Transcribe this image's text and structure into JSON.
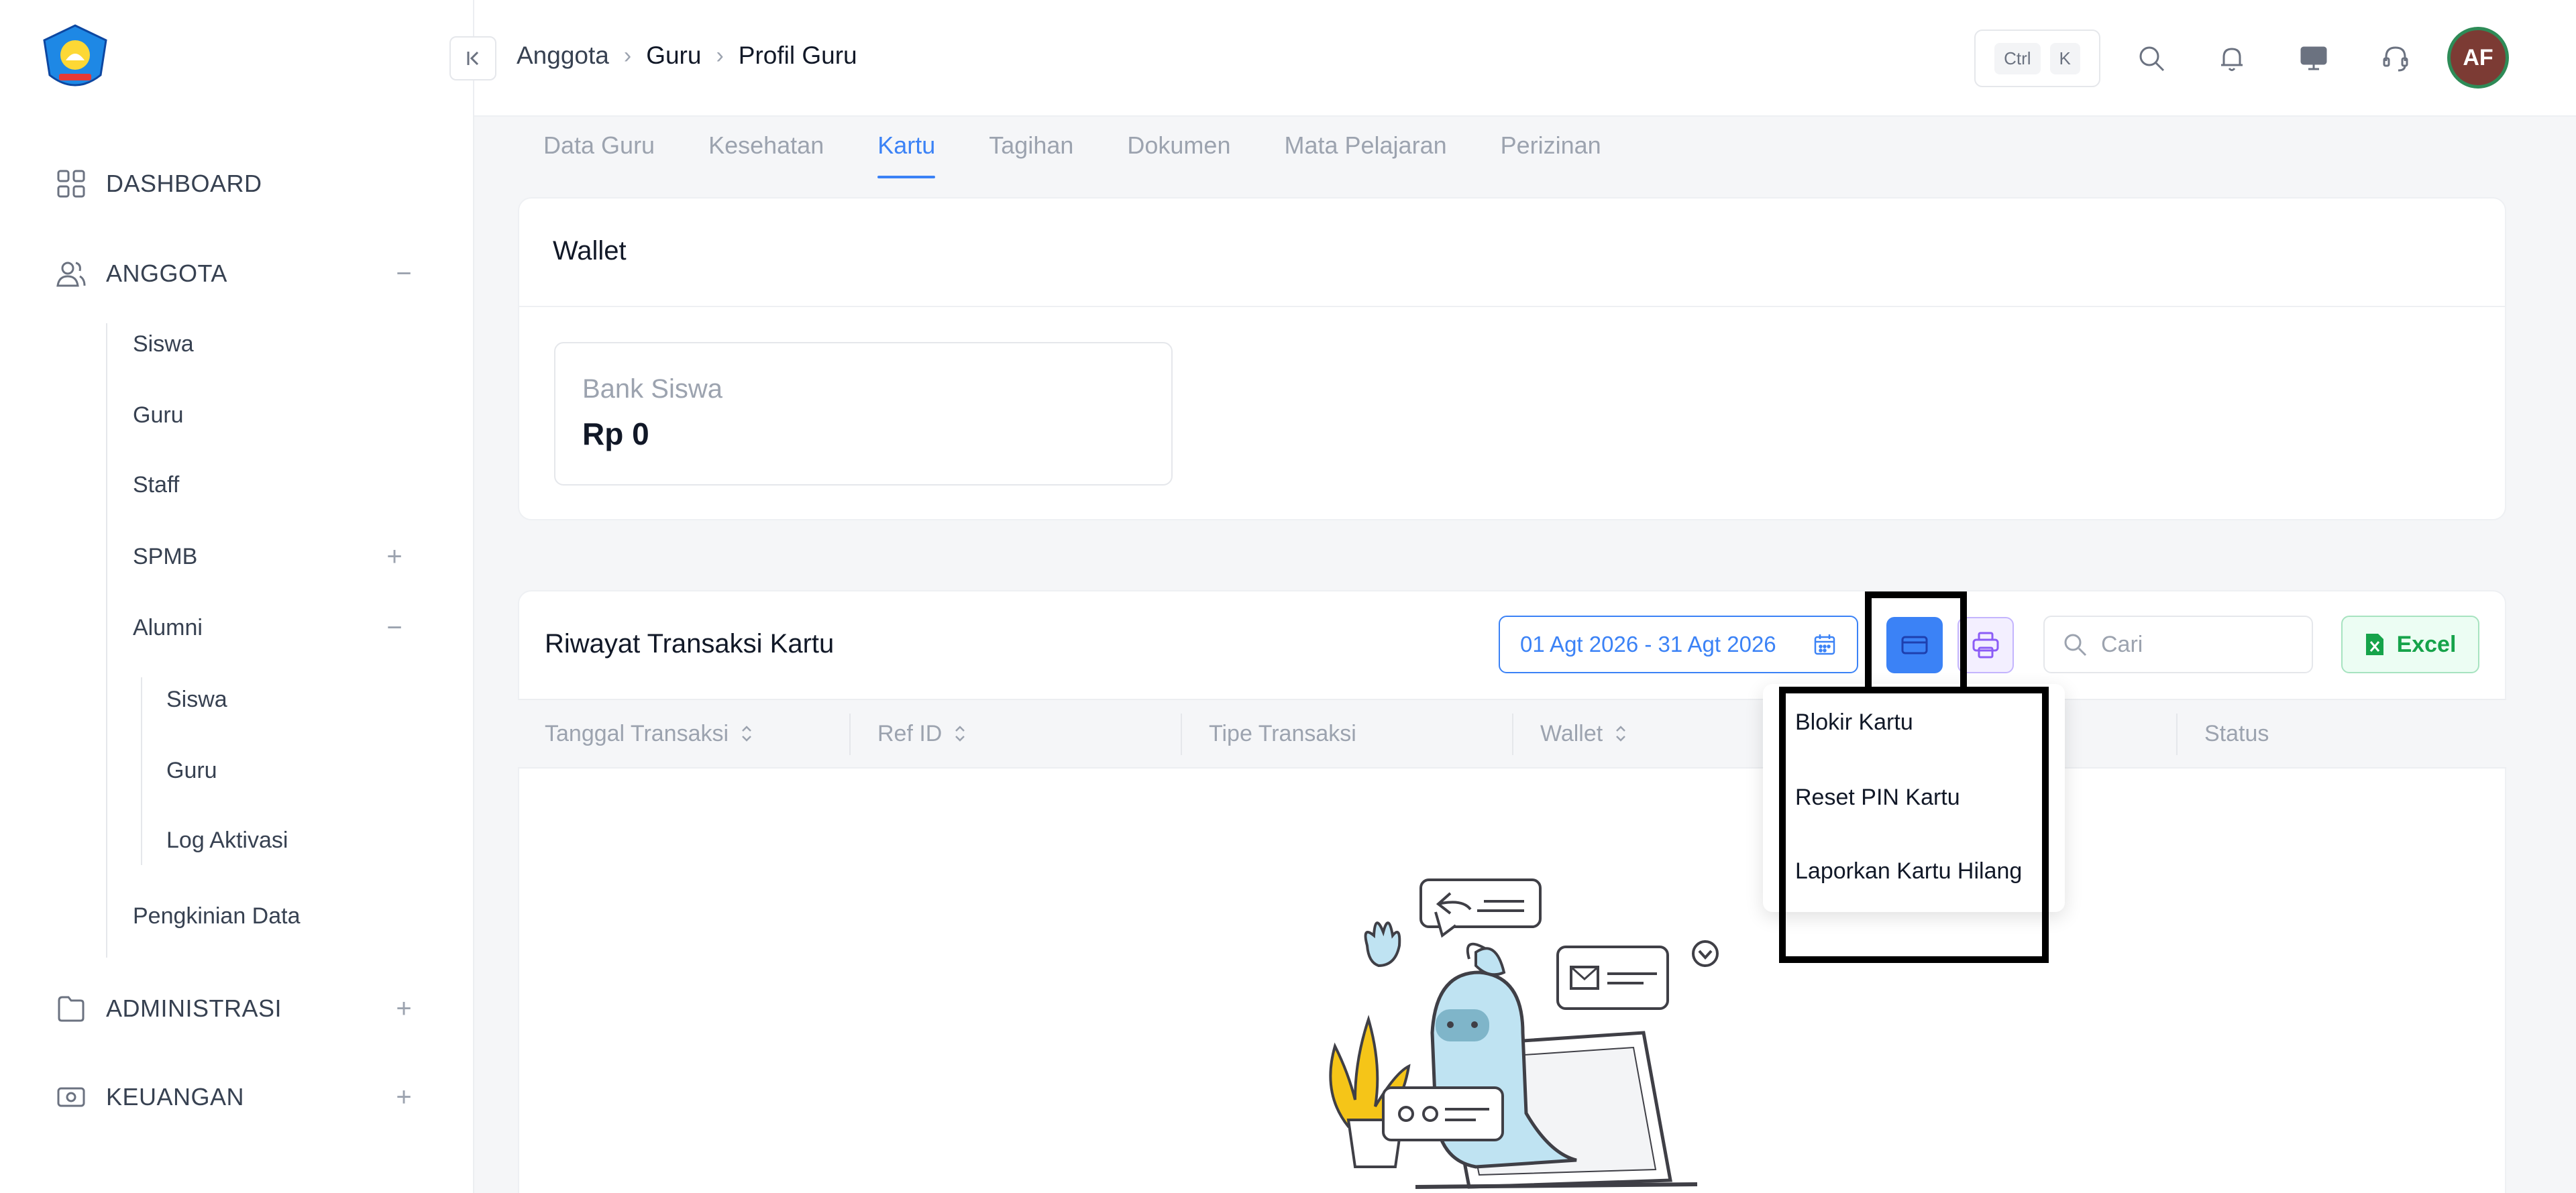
{
  "sidebar": {
    "items": [
      {
        "label": "DASHBOARD",
        "icon": "grid-icon"
      },
      {
        "label": "ANGGOTA",
        "icon": "users-icon",
        "toggle": "−"
      },
      {
        "label": "ADMINISTRASI",
        "icon": "folder-icon",
        "toggle": "+"
      },
      {
        "label": "KEUANGAN",
        "icon": "money-icon",
        "toggle": "+"
      }
    ],
    "anggota_sub": {
      "siswa": "Siswa",
      "guru": "Guru",
      "staff": "Staff",
      "spmb": "SPMB",
      "spmb_toggle": "+",
      "alumni": "Alumni",
      "alumni_toggle": "−",
      "alumni_siswa": "Siswa",
      "alumni_guru": "Guru",
      "log_aktivasi": "Log Aktivasi",
      "pengkinian": "Pengkinian Data"
    }
  },
  "breadcrumb": {
    "items": [
      "Anggota",
      "Guru",
      "Profil Guru"
    ],
    "separator": "›"
  },
  "topbar": {
    "kbd_ctrl": "Ctrl",
    "kbd_k": "K",
    "avatar_initials": "AF"
  },
  "tabs": [
    "Data Guru",
    "Kesehatan",
    "Kartu",
    "Tagihan",
    "Dokumen",
    "Mata Pelajaran",
    "Perizinan"
  ],
  "active_tab": "Kartu",
  "wallet": {
    "title": "Wallet",
    "bank_label": "Bank Siswa",
    "bank_amount": "Rp 0"
  },
  "transactions": {
    "title": "Riwayat Transaksi Kartu",
    "date_range": "01 Agt 2026 - 31 Agt 2026",
    "search_placeholder": "Cari",
    "excel_label": "Excel",
    "columns": [
      "Tanggal Transaksi",
      "Ref ID",
      "Tipe Transaksi",
      "Wallet",
      "Status"
    ]
  },
  "dropdown": {
    "items": [
      "Blokir Kartu",
      "Reset PIN Kartu",
      "Laporkan Kartu Hilang"
    ]
  },
  "colors": {
    "accent": "#3b82f6",
    "excel_green": "#16a34a",
    "avatar_bg": "#7c3b34"
  }
}
